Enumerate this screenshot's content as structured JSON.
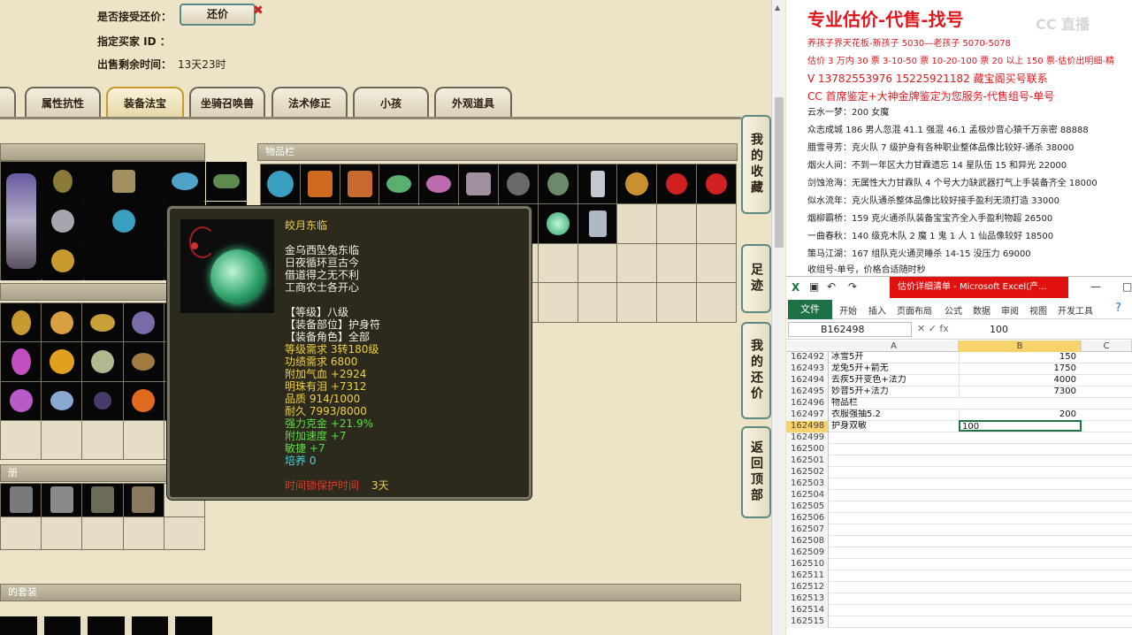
{
  "game": {
    "accept_haggle_label": "是否接受还价：",
    "haggle_button": "还价",
    "buyer_label": "指定买家 ID ：",
    "remaining_label": "出售剩余时间：",
    "remaining_value": "13天23时",
    "tabs": [
      "属性抗性",
      "装备法宝",
      "坐骑召唤兽",
      "法术修正",
      "小孩",
      "外观道具"
    ],
    "inventory_title": "物品栏",
    "left_panel_title": "册",
    "bottom_panel_title": "的套装",
    "side_buttons": [
      "我的收藏",
      "足迹",
      "我的还价",
      "返回顶部"
    ]
  },
  "tooltip": {
    "name": "皎月东临",
    "desc": [
      "金乌西坠兔东临",
      "日夜循环亘古今",
      "借道得之无不利",
      "工商农士各开心"
    ],
    "level": "【等级】八级",
    "slot": "【装备部位】护身符",
    "role": "【装备角色】全部",
    "req_level": "等级需求 3转180级",
    "req_merit": "功绩需求 6800",
    "bonus_hp": "附加气血 +2924",
    "bonus_mingzhu": "明珠有泪 +7312",
    "quality": "品质 914/1000",
    "durability": "耐久 7993/8000",
    "strong_gold": "强力克金 +21.9%",
    "bonus_speed": "附加速度 +7",
    "agility": "敏捷 +7",
    "cultivate": "培养 0",
    "time_protect_label": "时间锁保护时间",
    "time_protect_value": "3天"
  },
  "ad": {
    "title": "专业估价-代售-找号",
    "watermark": "CC 直播",
    "lines": [
      {
        "text": "养孩子界天花板-新孩子 5030—老孩子 5070-5078",
        "style": "red"
      },
      {
        "text": "估价 3 万内 30 票  3-10-50 票  10-20-100 票  20 以上 150 票-估价出明细-精",
        "style": "red"
      },
      {
        "text": "V  13782553976     15225921182   藏宝阁买号联系",
        "style": "red big"
      },
      {
        "text": "CC 首席鉴定+大神金牌鉴定为您服务-代售组号-单号",
        "style": "red big"
      },
      {
        "text": "云水一梦：200 女魔",
        "style": "black"
      },
      {
        "text": "众志成城 186 男人忽混 41.1 强混 46.1 孟极炒音心猿千万亲密 88888",
        "style": "black"
      },
      {
        "text": "腊雪寻芳：克火队 7 级护身有各种职业整体品像比较好-通杀 38000",
        "style": "black"
      },
      {
        "text": "烟火人间：不到一年区大力甘霖遗忘 14 星队伍 15 和异光 22000",
        "style": "black"
      },
      {
        "text": "剑蚀沧海：无属性大力甘霖队 4 个号大力缺武器打气上手装备齐全 18000",
        "style": "black"
      },
      {
        "text": "似水流年：克火队通杀整体品像比较好接手盈利无须打造 33000",
        "style": "black"
      },
      {
        "text": "烟柳霸桥：159 克火通杀队装备宝宝齐全入手盈利物超 26500",
        "style": "black"
      },
      {
        "text": "一曲春秋：140 级克木队 2 魔 1 鬼 1 人 1 仙品像较好 18500",
        "style": "black"
      },
      {
        "text": "策马江湖：167 组队克火通灵睡杀 14-15 没压力 69000",
        "style": "black"
      },
      {
        "text": "收组号-单号，价格合适随时秒",
        "style": "black"
      }
    ]
  },
  "excel": {
    "title": "估价详细清单 - Microsoft Excel(产...",
    "tabs": [
      "开始",
      "插入",
      "页面布局",
      "公式",
      "数据",
      "审阅",
      "视图",
      "开发工具"
    ],
    "file_tab": "文件",
    "name_box": "B162498",
    "formula_value": "100",
    "columns": [
      "A",
      "B",
      "C"
    ],
    "rows": [
      {
        "n": "162492",
        "a": "冰雪5开",
        "b": "150"
      },
      {
        "n": "162493",
        "a": "龙兔5开+箭无",
        "b": "1750"
      },
      {
        "n": "162494",
        "a": "去疾5开变色+法力",
        "b": "4000"
      },
      {
        "n": "162495",
        "a": "妙音5开+法力",
        "b": "7300"
      },
      {
        "n": "162496",
        "a": "物品栏",
        "b": ""
      },
      {
        "n": "162497",
        "a": "衣服强抽5.2",
        "b": "200"
      },
      {
        "n": "162498",
        "a": "护身双敏",
        "b": "100"
      },
      {
        "n": "162499",
        "a": "",
        "b": ""
      },
      {
        "n": "162500",
        "a": "",
        "b": ""
      },
      {
        "n": "162501",
        "a": "",
        "b": ""
      },
      {
        "n": "162502",
        "a": "",
        "b": ""
      },
      {
        "n": "162503",
        "a": "",
        "b": ""
      },
      {
        "n": "162504",
        "a": "",
        "b": ""
      },
      {
        "n": "162505",
        "a": "",
        "b": ""
      },
      {
        "n": "162506",
        "a": "",
        "b": ""
      },
      {
        "n": "162507",
        "a": "",
        "b": ""
      },
      {
        "n": "162508",
        "a": "",
        "b": ""
      },
      {
        "n": "162509",
        "a": "",
        "b": ""
      },
      {
        "n": "162510",
        "a": "",
        "b": ""
      },
      {
        "n": "162511",
        "a": "",
        "b": ""
      },
      {
        "n": "162512",
        "a": "",
        "b": ""
      },
      {
        "n": "162513",
        "a": "",
        "b": ""
      },
      {
        "n": "162514",
        "a": "",
        "b": ""
      },
      {
        "n": "162515",
        "a": "",
        "b": ""
      }
    ]
  }
}
